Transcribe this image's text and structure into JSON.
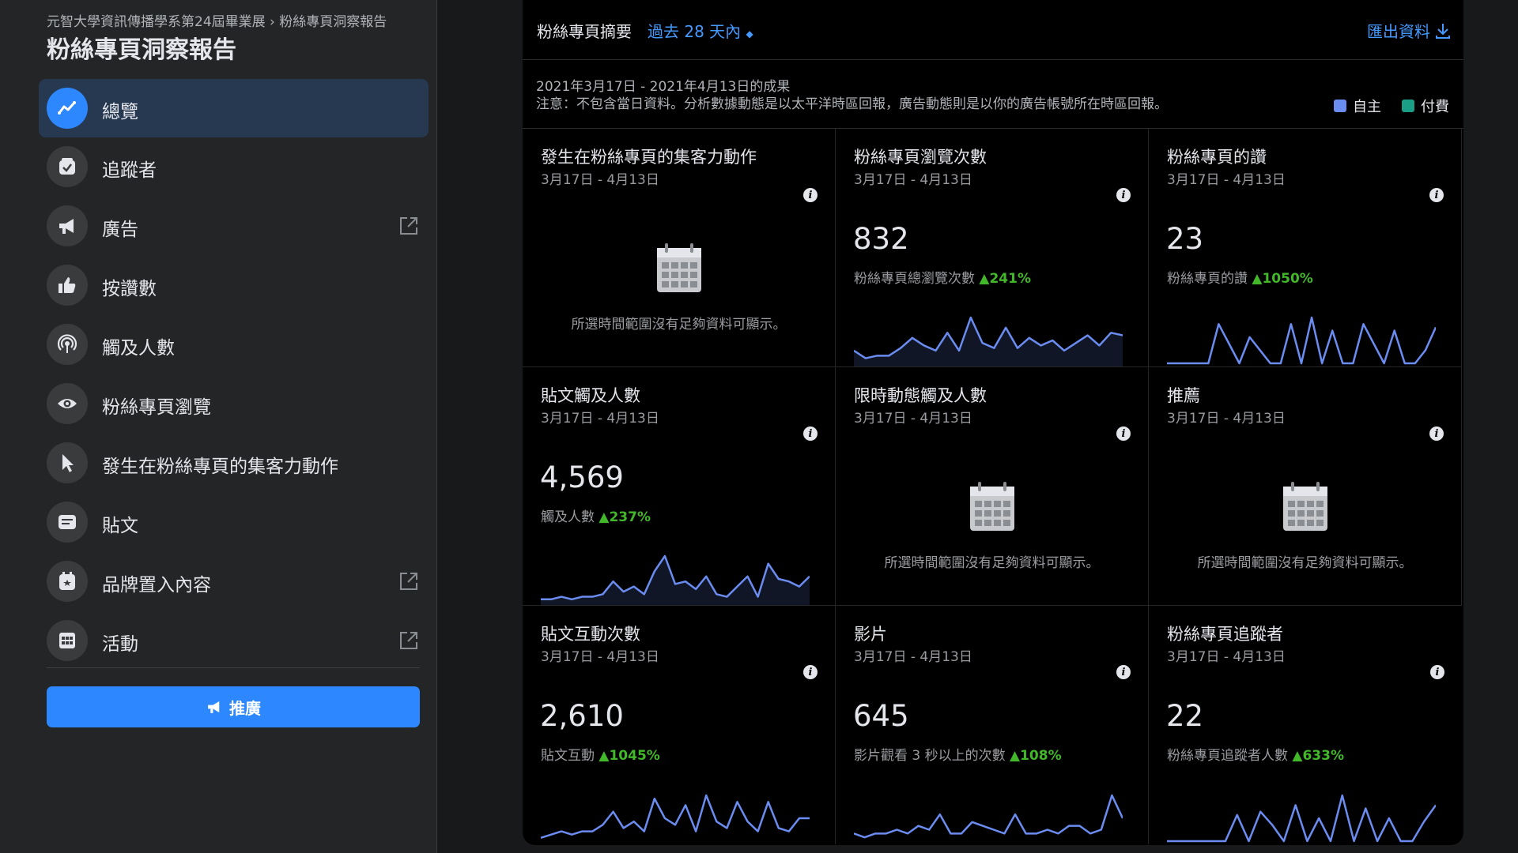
{
  "sidebar": {
    "breadcrumb": "元智大學資訊傳播學系第24屆畢業展 › 粉絲專頁洞察報告",
    "title": "粉絲專頁洞察報告",
    "items": [
      {
        "label": "總覽",
        "icon": "trend-line-icon",
        "active": true
      },
      {
        "label": "追蹤者",
        "icon": "checkbox-icon"
      },
      {
        "label": "廣告",
        "icon": "megaphone-icon",
        "external": true
      },
      {
        "label": "按讚數",
        "icon": "thumbs-up-icon"
      },
      {
        "label": "觸及人數",
        "icon": "broadcast-icon"
      },
      {
        "label": "粉絲專頁瀏覽",
        "icon": "eye-icon"
      },
      {
        "label": "發生在粉絲專頁的集客力動作",
        "icon": "cursor-icon"
      },
      {
        "label": "貼文",
        "icon": "post-icon"
      },
      {
        "label": "品牌置入內容",
        "icon": "branded-content-icon",
        "external": true
      },
      {
        "label": "活動",
        "icon": "calendar-grid-icon",
        "external": true
      }
    ],
    "promote_label": "推廣"
  },
  "summary": {
    "title": "粉絲專頁摘要",
    "range": "過去 28 天內",
    "export": "匯出資料",
    "date_range": "2021年3月17日 - 2021年4月13日的成果",
    "notice": "注意：不包含當日資料。分析數據動態是以太平洋時區回報，廣告動態則是以你的廣告帳號所在時區回報。",
    "legend_organic": "自主",
    "legend_paid": "付費",
    "color_organic": "#6b8cf0",
    "color_paid": "#1a9e86"
  },
  "cards": [
    {
      "title": "發生在粉絲專頁的集客力動作",
      "date": "3月17日 - 4月13日",
      "empty": true,
      "empty_text": "所選時間範圍沒有足夠資料可顯示。"
    },
    {
      "title": "粉絲專頁瀏覽次數",
      "date": "3月17日 - 4月13日",
      "value": "832",
      "sub": "粉絲專頁總瀏覽次數",
      "change": "▲241%"
    },
    {
      "title": "粉絲專頁的讚",
      "date": "3月17日 - 4月13日",
      "value": "23",
      "sub": "粉絲專頁的讚",
      "change": "▲1050%"
    },
    {
      "title": "貼文觸及人數",
      "date": "3月17日 - 4月13日",
      "value": "4,569",
      "sub": "觸及人數",
      "change": "▲237%"
    },
    {
      "title": "限時動態觸及人數",
      "date": "3月17日 - 4月13日",
      "empty": true,
      "empty_text": "所選時間範圍沒有足夠資料可顯示。"
    },
    {
      "title": "推薦",
      "date": "3月17日 - 4月13日",
      "empty": true,
      "empty_text": "所選時間範圍沒有足夠資料可顯示。"
    },
    {
      "title": "貼文互動次數",
      "date": "3月17日 - 4月13日",
      "value": "2,610",
      "sub": "貼文互動",
      "change": "▲1045%"
    },
    {
      "title": "影片",
      "date": "3月17日 - 4月13日",
      "value": "645",
      "sub": "影片觀看 3 秒以上的次數",
      "change": "▲108%"
    },
    {
      "title": "粉絲專頁追蹤者",
      "date": "3月17日 - 4月13日",
      "value": "22",
      "sub": "粉絲專頁追蹤者人數",
      "change": "▲633%"
    }
  ],
  "sparklines": {
    "1": [
      5,
      2,
      3,
      3,
      6,
      10,
      7,
      5,
      12,
      5,
      18,
      8,
      6,
      14,
      6,
      10,
      7,
      9,
      5,
      8,
      11,
      7,
      12,
      11
    ],
    "2": [
      0,
      0,
      0,
      0,
      0,
      12,
      6,
      0,
      8,
      4,
      0,
      0,
      12,
      0,
      14,
      0,
      10,
      0,
      0,
      12,
      6,
      0,
      10,
      0,
      0,
      4,
      11
    ],
    "3": [
      1,
      1,
      2,
      1,
      2,
      2,
      3,
      8,
      4,
      6,
      3,
      12,
      18,
      7,
      8,
      5,
      10,
      3,
      2,
      6,
      10,
      2,
      15,
      9,
      8,
      6,
      10
    ],
    "6": [
      1,
      2,
      3,
      2,
      3,
      3,
      5,
      9,
      4,
      6,
      3,
      13,
      7,
      5,
      11,
      3,
      14,
      6,
      4,
      12,
      6,
      3,
      12,
      4,
      3,
      7,
      7
    ],
    "7": [
      2,
      1,
      2,
      2,
      3,
      2,
      4,
      3,
      7,
      2,
      2,
      5,
      4,
      3,
      2,
      7,
      2,
      2,
      3,
      2,
      4,
      4,
      2,
      3,
      12,
      6
    ],
    "8": [
      0,
      0,
      0,
      0,
      0,
      0,
      8,
      0,
      9,
      5,
      0,
      11,
      0,
      7,
      0,
      14,
      0,
      10,
      0,
      7,
      0,
      0,
      6,
      11
    ]
  }
}
